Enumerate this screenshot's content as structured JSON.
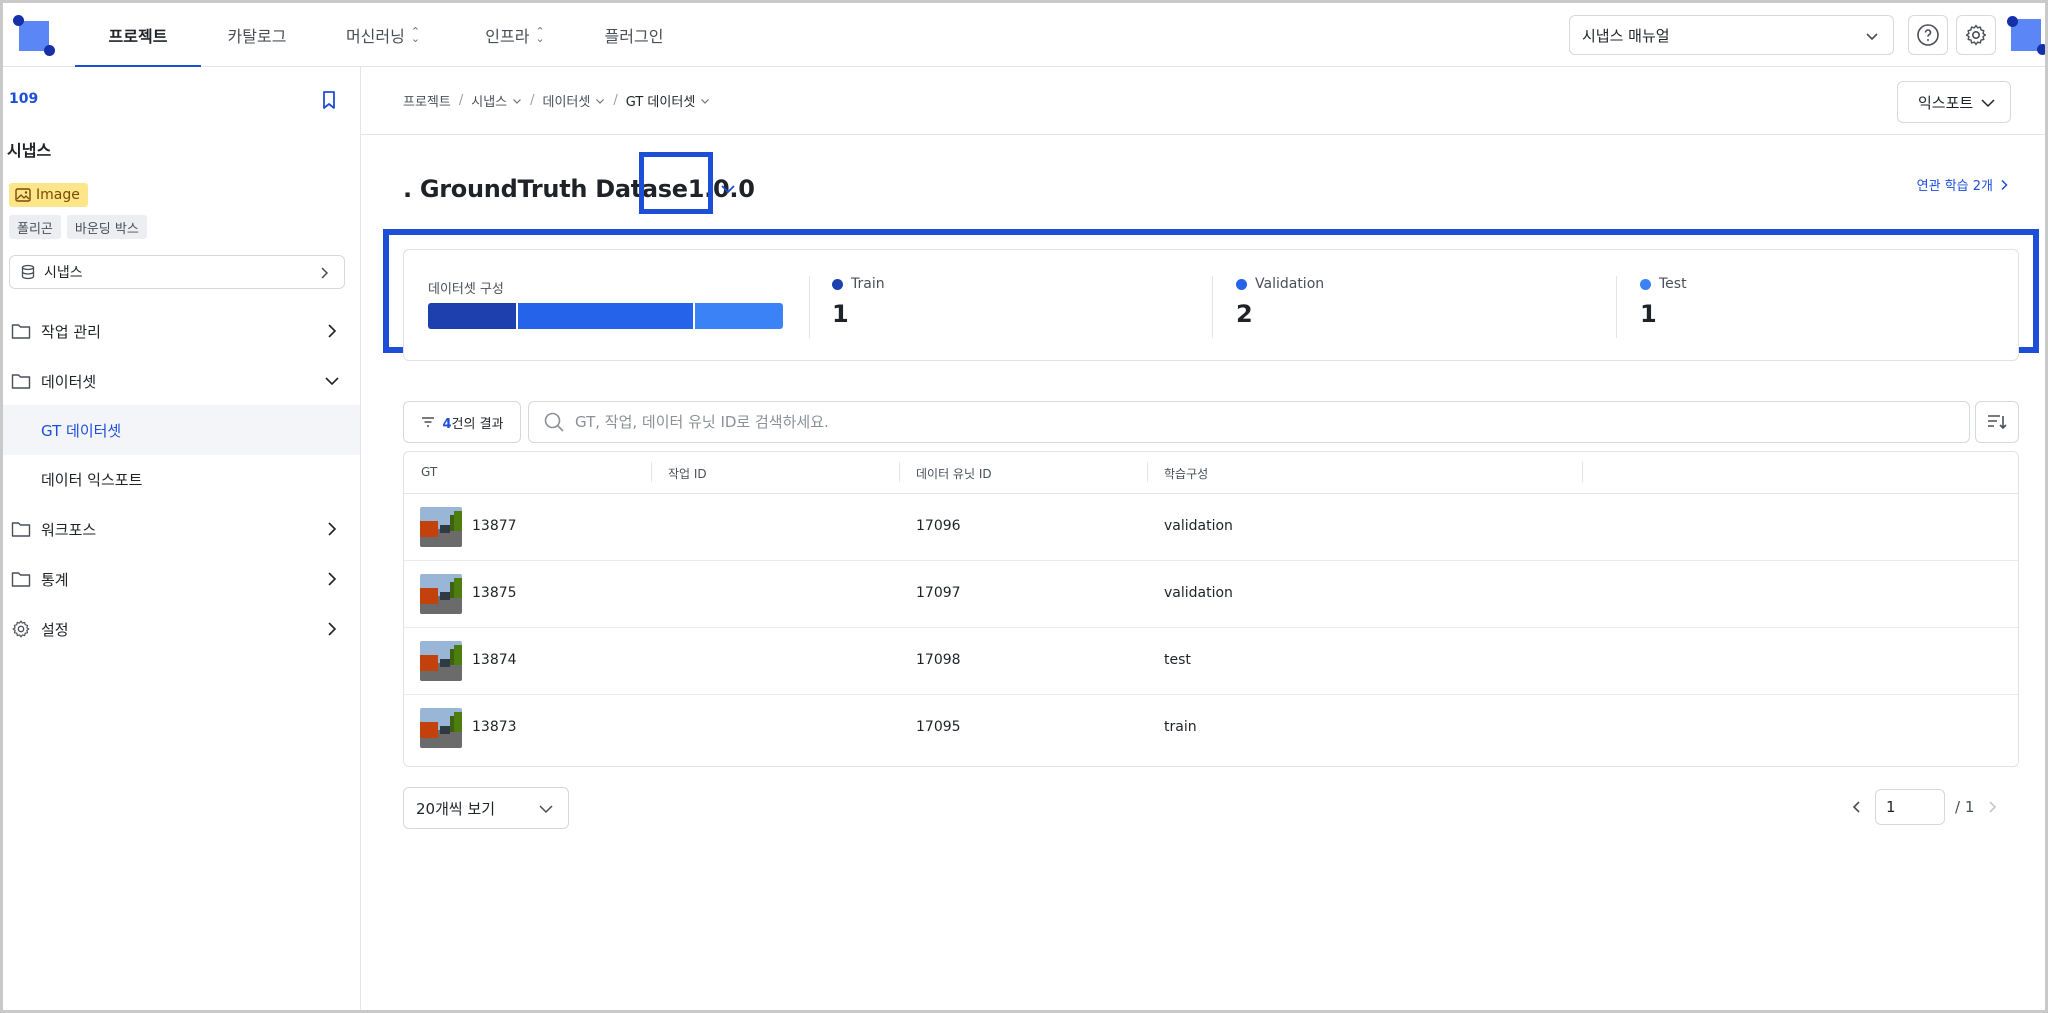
{
  "nav": {
    "tabs": [
      {
        "label": "프로젝트",
        "active": true
      },
      {
        "label": "카탈로그"
      },
      {
        "label": "머신러닝"
      },
      {
        "label": "인프라"
      },
      {
        "label": "플러그인"
      }
    ],
    "manual_select": "시냅스 매뉴얼"
  },
  "sidebar": {
    "project_id": "109",
    "project_name": "시냅스",
    "type_badge": "Image",
    "tags": [
      "폴리곤",
      "바운딩 박스"
    ],
    "db_button": "시냅스",
    "menu": [
      {
        "label": "작업 관리"
      },
      {
        "label": "데이터셋"
      },
      {
        "label": "GT 데이터셋"
      },
      {
        "label": "데이터 익스포트"
      },
      {
        "label": "워크포스"
      },
      {
        "label": "통계"
      },
      {
        "label": "설정"
      }
    ]
  },
  "breadcrumb": [
    "프로젝트",
    "시냅스",
    "데이터셋",
    "GT 데이터셋"
  ],
  "export_label": "익스포트",
  "dataset": {
    "title_prefix": ". GroundTruth Datase",
    "version": "1.0.0",
    "related_link": "연관 학습 2개"
  },
  "composition": {
    "label": "데이터셋 구성",
    "colors": {
      "train": "#1e40af",
      "validation": "#2563eb",
      "test": "#3b82f6"
    },
    "bar_fractions": [
      0.25,
      0.5,
      0.25
    ],
    "stats": [
      {
        "name": "Train",
        "value": "1"
      },
      {
        "name": "Validation",
        "value": "2"
      },
      {
        "name": "Test",
        "value": "1"
      }
    ]
  },
  "filter": {
    "count": "4",
    "suffix": "건의 결과"
  },
  "search": {
    "placeholder": "GT, 작업, 데이터 유닛 ID로 검색하세요."
  },
  "table": {
    "headers": [
      "GT",
      "작업 ID",
      "데이터 유닛 ID",
      "학습구성"
    ],
    "rows": [
      {
        "gt": "13877",
        "task": "",
        "unit": "17096",
        "split": "validation"
      },
      {
        "gt": "13875",
        "task": "",
        "unit": "17097",
        "split": "validation"
      },
      {
        "gt": "13874",
        "task": "",
        "unit": "17098",
        "split": "test"
      },
      {
        "gt": "13873",
        "task": "",
        "unit": "17095",
        "split": "train"
      }
    ]
  },
  "pagination": {
    "page_size": "20개씩 보기",
    "current_page": "1",
    "total_pages": "/ 1"
  }
}
